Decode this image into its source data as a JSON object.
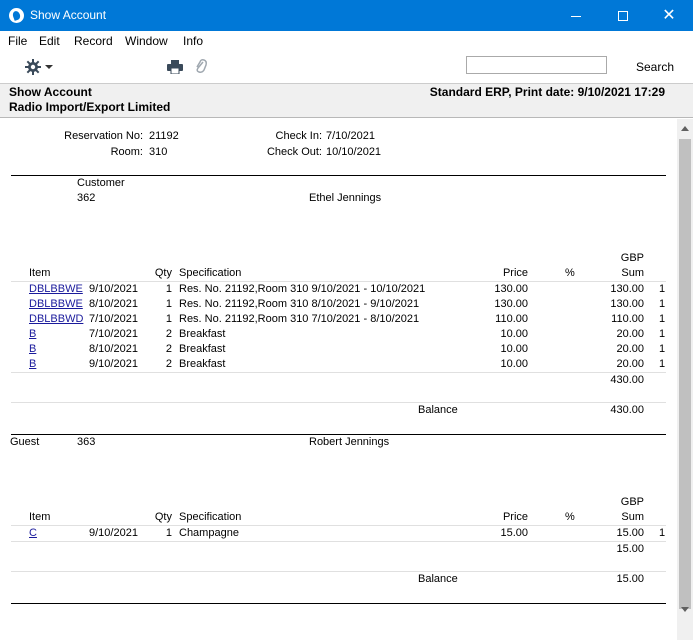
{
  "window": {
    "title": "Show Account"
  },
  "menu": [
    "File",
    "Edit",
    "Record",
    "Window",
    "Info"
  ],
  "toolbar": {
    "search_label": "Search",
    "search_value": ""
  },
  "header": {
    "title": "Show Account",
    "company": "Radio Import/Export Limited",
    "right": "Standard ERP, Print date: 9/10/2021 17:29"
  },
  "reservation": {
    "reservation_label": "Reservation No:",
    "reservation_no": "21192",
    "room_label": "Room:",
    "room": "310",
    "checkin_label": "Check In:",
    "checkin": "7/10/2021",
    "checkout_label": "Check Out:",
    "checkout": "10/10/2021"
  },
  "section1": {
    "label": "Customer",
    "code": "362",
    "name": "Ethel Jennings",
    "col_item": "Item",
    "col_qty": "Qty",
    "col_spec": "Specification",
    "col_price": "Price",
    "col_pct": "%",
    "col_currency": "GBP",
    "col_sum": "Sum",
    "rows": [
      {
        "item": "DBLBBWE",
        "date": "9/10/2021",
        "qty": "1",
        "spec": "Res. No. 21192,Room 310 9/10/2021 - 10/10/2021",
        "price": "130.00",
        "sum": "130.00",
        "flag": "1"
      },
      {
        "item": "DBLBBWE",
        "date": "8/10/2021",
        "qty": "1",
        "spec": "Res. No. 21192,Room 310 8/10/2021 - 9/10/2021",
        "price": "130.00",
        "sum": "130.00",
        "flag": "1"
      },
      {
        "item": "DBLBBWD",
        "date": "7/10/2021",
        "qty": "1",
        "spec": "Res. No. 21192,Room 310 7/10/2021 - 8/10/2021",
        "price": "110.00",
        "sum": "110.00",
        "flag": "1"
      },
      {
        "item": "B",
        "date": "7/10/2021",
        "qty": "2",
        "spec": "Breakfast",
        "price": "10.00",
        "sum": "20.00",
        "flag": "1"
      },
      {
        "item": "B",
        "date": "8/10/2021",
        "qty": "2",
        "spec": "Breakfast",
        "price": "10.00",
        "sum": "20.00",
        "flag": "1"
      },
      {
        "item": "B",
        "date": "9/10/2021",
        "qty": "2",
        "spec": "Breakfast",
        "price": "10.00",
        "sum": "20.00",
        "flag": "1"
      }
    ],
    "total": "430.00",
    "balance_label": "Balance",
    "balance": "430.00"
  },
  "section2": {
    "label": "Guest",
    "code": "363",
    "name": "Robert Jennings",
    "col_item": "Item",
    "col_qty": "Qty",
    "col_spec": "Specification",
    "col_price": "Price",
    "col_pct": "%",
    "col_currency": "GBP",
    "col_sum": "Sum",
    "rows": [
      {
        "item": "C",
        "date": "9/10/2021",
        "qty": "1",
        "spec": "Champagne",
        "price": "15.00",
        "sum": "15.00",
        "flag": "1"
      }
    ],
    "total": "15.00",
    "balance_label": "Balance",
    "balance": "15.00"
  }
}
